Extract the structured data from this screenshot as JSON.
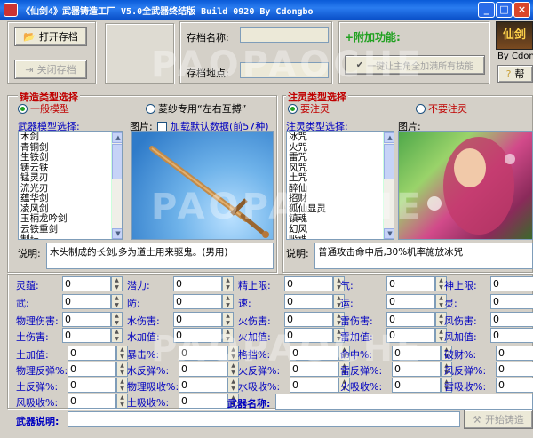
{
  "window": {
    "title": "《仙剑4》武器铸造工厂 V5.0全武器终结版 Build 0920 By Cdongbo"
  },
  "toolbar": {
    "open_label": "打开存档",
    "close_label": "关闭存档",
    "save_name_label": "存档名称:",
    "save_location_label": "存档地点:",
    "extra_title": "+附加功能:",
    "extra_button_label": "一键让主角全加满所有技能",
    "logo_text": "仙剑",
    "logo_by": "By Cdon",
    "help_label": "帮"
  },
  "watermark": "PAOPAOCHE",
  "forge": {
    "group_title": "铸造类型选择",
    "radio_normal": "一般模型",
    "radio_special": "菱纱专用“左右互搏”",
    "model_label": "武器模型选择:",
    "image_label": "图片:",
    "checkbox_label": "加载默认数据(前57种)",
    "models": [
      "木剑",
      "青铜剑",
      "生铁剑",
      "铸云铁",
      "锰灵刃",
      "流光刃",
      "蕴华剑",
      "凌风剑",
      "玉柄龙吟剑",
      "云铁重剑",
      "制珏"
    ],
    "desc_label": "说明:",
    "description": "木头制成的长剑,多为道士用来驱鬼。(男用)"
  },
  "spirit": {
    "group_title": "注灵类型选择",
    "radio_yes": "要注灵",
    "radio_no": "不要注灵",
    "spirit_label": "注灵类型选择:",
    "image_label": "图片:",
    "spirits": [
      "冰咒",
      "火咒",
      "雷咒",
      "风咒",
      "土咒",
      "醉仙",
      "招财",
      "狐仙显灵",
      "镇魂",
      "幻风",
      "吸魂"
    ],
    "desc_label": "说明:",
    "description": "普通攻击命中后,30%机率施放冰咒"
  },
  "stats": {
    "row1": [
      "灵蕴:",
      "潜力:",
      "精上限:",
      "气:",
      "神上限:"
    ],
    "row2": [
      "武:",
      "防:",
      "速:",
      "运:",
      "灵:"
    ],
    "row3": [
      "物理伤害:",
      "水伤害:",
      "火伤害:",
      "雷伤害:",
      "风伤害:"
    ],
    "row4": [
      "土伤害:",
      "水加值:",
      "火加值:",
      "雷加值:",
      "风加值:"
    ],
    "row5": [
      "土加值:",
      "暴击%:",
      "格挡%:",
      "命中%:",
      "破财%:"
    ],
    "row6": [
      "物理反弹%:",
      "水反弹%:",
      "火反弹%:",
      "雷反弹%:",
      "风反弹%:"
    ],
    "row7": [
      "土反弹%:",
      "物理吸收%:",
      "水吸收%:",
      "火吸收%:",
      "雷吸收%:"
    ],
    "row8": [
      "风吸收%:",
      "土吸收%:"
    ],
    "value": "0"
  },
  "bottom": {
    "weapon_name_label": "武器名称:",
    "weapon_desc_label": "武器说明:",
    "start_label": "开始铸造"
  }
}
